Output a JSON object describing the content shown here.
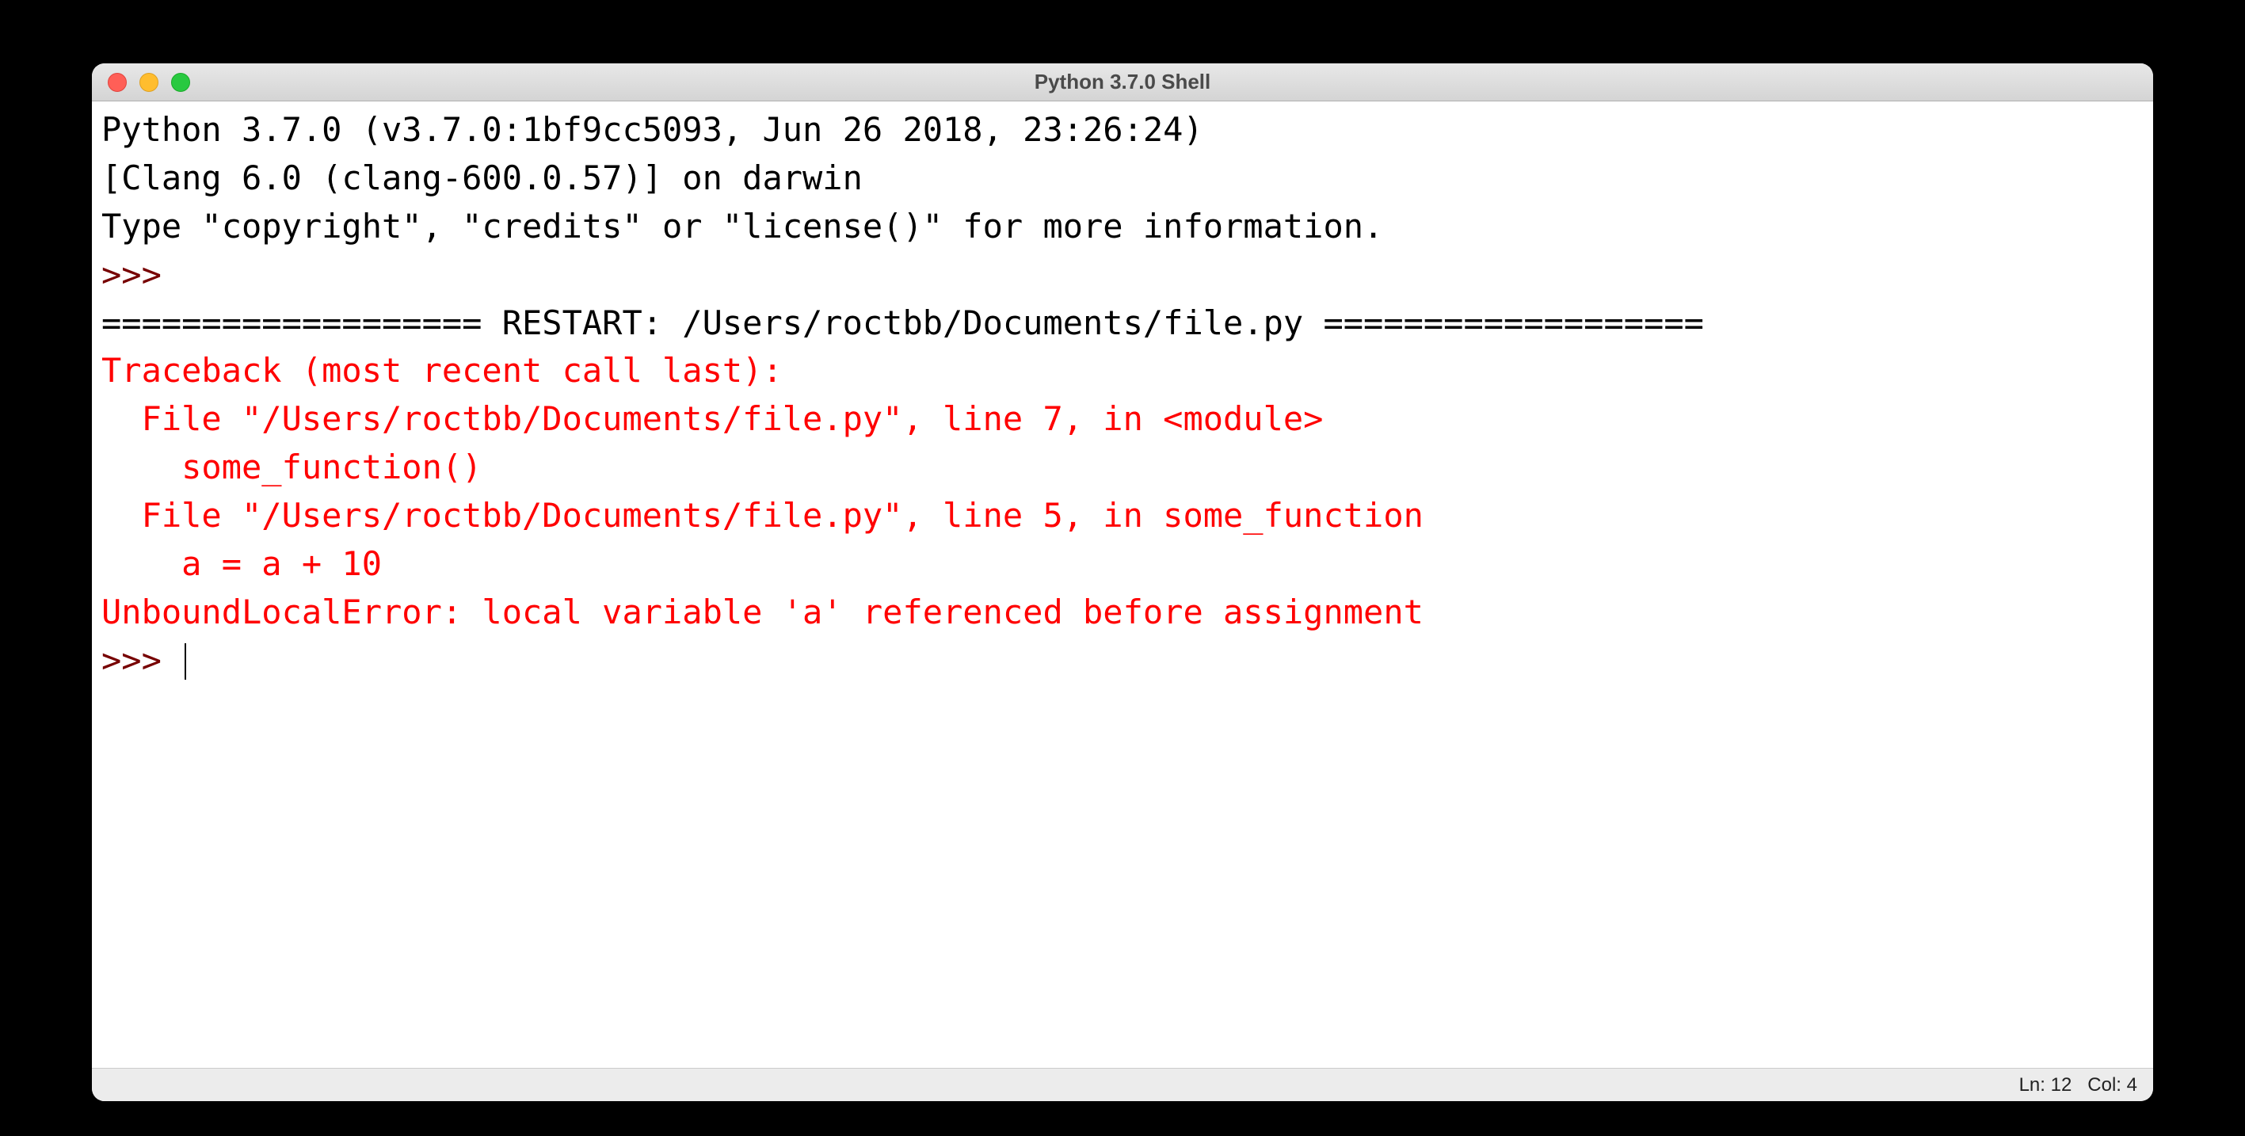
{
  "window": {
    "title": "Python 3.7.0 Shell"
  },
  "shell": {
    "version_line": "Python 3.7.0 (v3.7.0:1bf9cc5093, Jun 26 2018, 23:26:24) ",
    "compiler_line": "[Clang 6.0 (clang-600.0.57)] on darwin",
    "help_line": "Type \"copyright\", \"credits\" or \"license()\" for more information.",
    "prompt": ">>> ",
    "restart_line": "=================== RESTART: /Users/roctbb/Documents/file.py ===================",
    "traceback": {
      "header": "Traceback (most recent call last):",
      "frame1_file": "  File \"/Users/roctbb/Documents/file.py\", line 7, in <module>",
      "frame1_code": "    some_function()",
      "frame2_file": "  File \"/Users/roctbb/Documents/file.py\", line 5, in some_function",
      "frame2_code": "    a = a + 10",
      "error": "UnboundLocalError: local variable 'a' referenced before assignment"
    }
  },
  "status": {
    "line": "Ln: 12",
    "col": "Col: 4"
  }
}
